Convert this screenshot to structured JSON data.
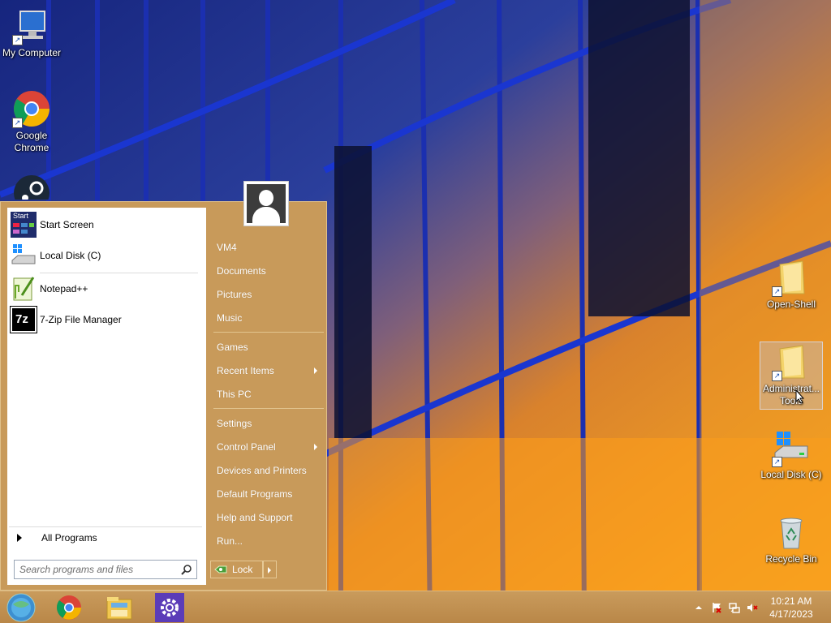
{
  "desktop": {
    "icons_left": [
      {
        "label": "My Computer",
        "icon": "computer-icon"
      },
      {
        "label": "Google Chrome",
        "icon": "chrome-icon"
      },
      {
        "label": "",
        "icon": "steam-icon"
      }
    ],
    "icons_right": [
      {
        "label": "Open-Shell",
        "icon": "folder-icon"
      },
      {
        "label": "Administrat... Tools",
        "icon": "folder-icon"
      },
      {
        "label": "Local Disk (C)",
        "icon": "drive-icon"
      },
      {
        "label": "Recycle Bin",
        "icon": "recycle-bin-icon"
      }
    ]
  },
  "start_menu": {
    "programs": [
      {
        "label": "Start Screen",
        "icon": "start-screen-icon",
        "icon_text": "Start"
      },
      {
        "label": "Local Disk (C)",
        "icon": "drive-icon"
      },
      {
        "label": "Notepad++",
        "icon": "notepadpp-icon"
      },
      {
        "label": "7-Zip File Manager",
        "icon": "7zip-icon",
        "icon_text": "7z"
      }
    ],
    "all_programs": "All Programs",
    "search_placeholder": "Search programs and files",
    "right_items": [
      {
        "label": "VM4"
      },
      {
        "label": "Documents"
      },
      {
        "label": "Pictures"
      },
      {
        "label": "Music"
      },
      {
        "label": "Games"
      },
      {
        "label": "Recent Items",
        "submenu": true
      },
      {
        "label": "This PC"
      },
      {
        "label": "Settings"
      },
      {
        "label": "Control Panel",
        "submenu": true
      },
      {
        "label": "Devices and Printers"
      },
      {
        "label": "Default Programs"
      },
      {
        "label": "Help and Support"
      },
      {
        "label": "Run..."
      }
    ],
    "lock_label": "Lock"
  },
  "taskbar": {
    "apps": [
      "start-orb-icon",
      "chrome-icon",
      "file-explorer-icon",
      "settings-gear-icon"
    ],
    "clock_time": "10:21 AM",
    "clock_date": "4/17/2023"
  },
  "colors": {
    "menu_bg": "#c89a5a",
    "taskbar_bg": "#c99b5c"
  }
}
